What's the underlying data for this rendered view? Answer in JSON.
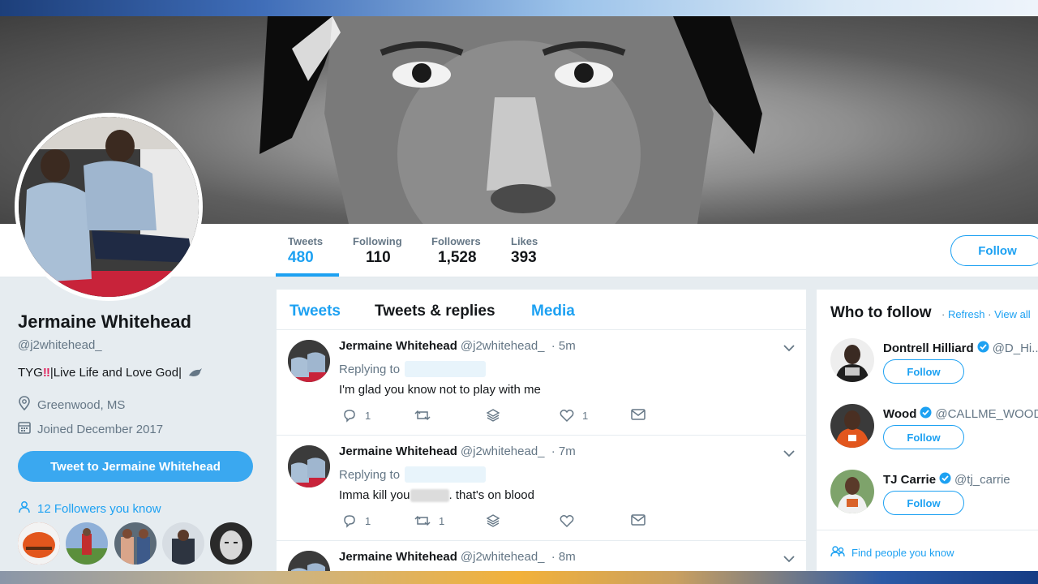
{
  "colors": {
    "accent": "#1da1f2",
    "text": "#14171a",
    "muted": "#657786",
    "bg": "#e6ecf0",
    "alert": "#e0245e"
  },
  "profile": {
    "name": "Jermaine Whitehead",
    "handle": "@j2whitehead_",
    "bio_prefix": "TYG",
    "bio_mark": "‼",
    "bio_text": "|Live Life and Love God|",
    "location": "Greenwood, MS",
    "joined": "Joined December 2017",
    "tweet_to_label": "Tweet to Jermaine Whitehead",
    "followers_you_know": "12 Followers you know"
  },
  "stats": [
    {
      "label": "Tweets",
      "value": "480"
    },
    {
      "label": "Following",
      "value": "110"
    },
    {
      "label": "Followers",
      "value": "1,528"
    },
    {
      "label": "Likes",
      "value": "393"
    }
  ],
  "follow_label": "Follow",
  "timeline": {
    "tabs": [
      "Tweets",
      "Tweets & replies",
      "Media"
    ],
    "tweets": [
      {
        "name": "Jermaine Whitehead",
        "handle": "@j2whitehead_",
        "time": "· 5m",
        "replying": "Replying to",
        "text": "I'm glad you know not to play with me",
        "text_after": "",
        "replies": "1",
        "retweets": "",
        "likes": "1"
      },
      {
        "name": "Jermaine Whitehead",
        "handle": "@j2whitehead_",
        "time": "· 7m",
        "replying": "Replying to",
        "text": "Imma kill you",
        "text_after": ". that's on blood",
        "replies": "1",
        "retweets": "1",
        "likes": ""
      },
      {
        "name": "Jermaine Whitehead",
        "handle": "@j2whitehead_",
        "time": "· 8m"
      }
    ]
  },
  "who_to_follow": {
    "title": "Who to follow",
    "refresh": "Refresh",
    "view_all": "View all",
    "dot": "·",
    "suggestions": [
      {
        "name": "Dontrell Hilliard",
        "handle": "@D_Hi..."
      },
      {
        "name": "Wood",
        "handle": "@CALLME_WOOD"
      },
      {
        "name": "TJ Carrie",
        "handle": "@tj_carrie"
      }
    ],
    "follow_label": "Follow",
    "find_people": "Find people you know"
  }
}
